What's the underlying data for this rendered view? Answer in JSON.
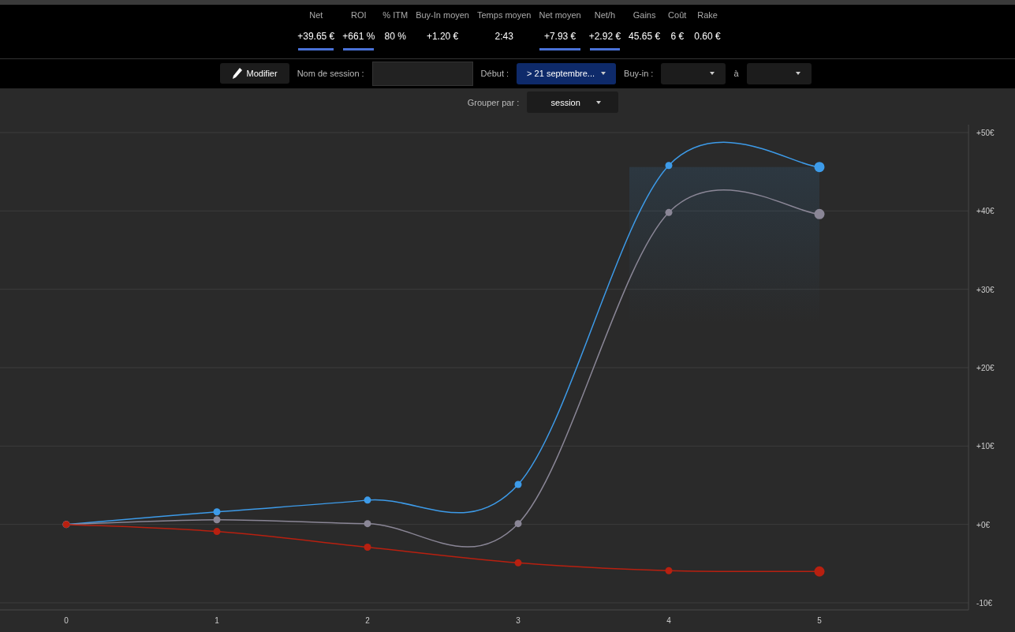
{
  "stats": [
    {
      "label": "Net",
      "value": "+39.65 €",
      "highlighted": true
    },
    {
      "label": "ROI",
      "value": "+661 %",
      "highlighted": true
    },
    {
      "label": "% ITM",
      "value": "80 %",
      "highlighted": false
    },
    {
      "label": "Buy-In moyen",
      "value": "+1.20 €",
      "highlighted": false
    },
    {
      "label": "Temps moyen",
      "value": "2:43",
      "highlighted": false
    },
    {
      "label": "Net moyen",
      "value": "+7.93 €",
      "highlighted": true
    },
    {
      "label": "Net/h",
      "value": "+2.92 €",
      "highlighted": true
    },
    {
      "label": "Gains",
      "value": "45.65 €",
      "highlighted": false
    },
    {
      "label": "Coût",
      "value": "6 €",
      "highlighted": false
    },
    {
      "label": "Rake",
      "value": "0.60 €",
      "highlighted": false
    }
  ],
  "toolbar": {
    "edit_button": "Modifier",
    "session_name_label": "Nom de session :",
    "start_label": "Début :",
    "start_value": "> 21 septembre...",
    "buyin_label": "Buy-in :",
    "to_label": "à"
  },
  "group_by": {
    "label": "Grouper par :",
    "value": "session"
  },
  "chart_data": {
    "type": "line",
    "x": [
      0,
      1,
      2,
      3,
      4,
      5
    ],
    "xlim": [
      -0.44,
      5.99
    ],
    "grid": true,
    "xticks": [
      0,
      1,
      2,
      3,
      4,
      5
    ],
    "ylim": [
      -10,
      50
    ],
    "yticks": [
      {
        "value": 50,
        "label": "+50€"
      },
      {
        "value": 40,
        "label": "+40€"
      },
      {
        "value": 30,
        "label": "+30€"
      },
      {
        "value": 20,
        "label": "+20€"
      },
      {
        "value": 10,
        "label": "+10€"
      },
      {
        "value": 0,
        "label": "+0€"
      },
      {
        "value": -10,
        "label": "-10€"
      }
    ],
    "series": [
      {
        "color": "#3d9be9",
        "marker": "circle",
        "values": [
          0,
          1.6,
          3.1,
          5.1,
          45.8,
          45.6
        ]
      },
      {
        "color": "#8a8696",
        "marker": "circle",
        "values": [
          0,
          0.6,
          0.1,
          0.1,
          39.8,
          39.6
        ]
      },
      {
        "color": "#b82010",
        "marker": "circle",
        "values": [
          0,
          -0.9,
          -2.9,
          -4.9,
          -5.9,
          -6
        ]
      }
    ]
  }
}
